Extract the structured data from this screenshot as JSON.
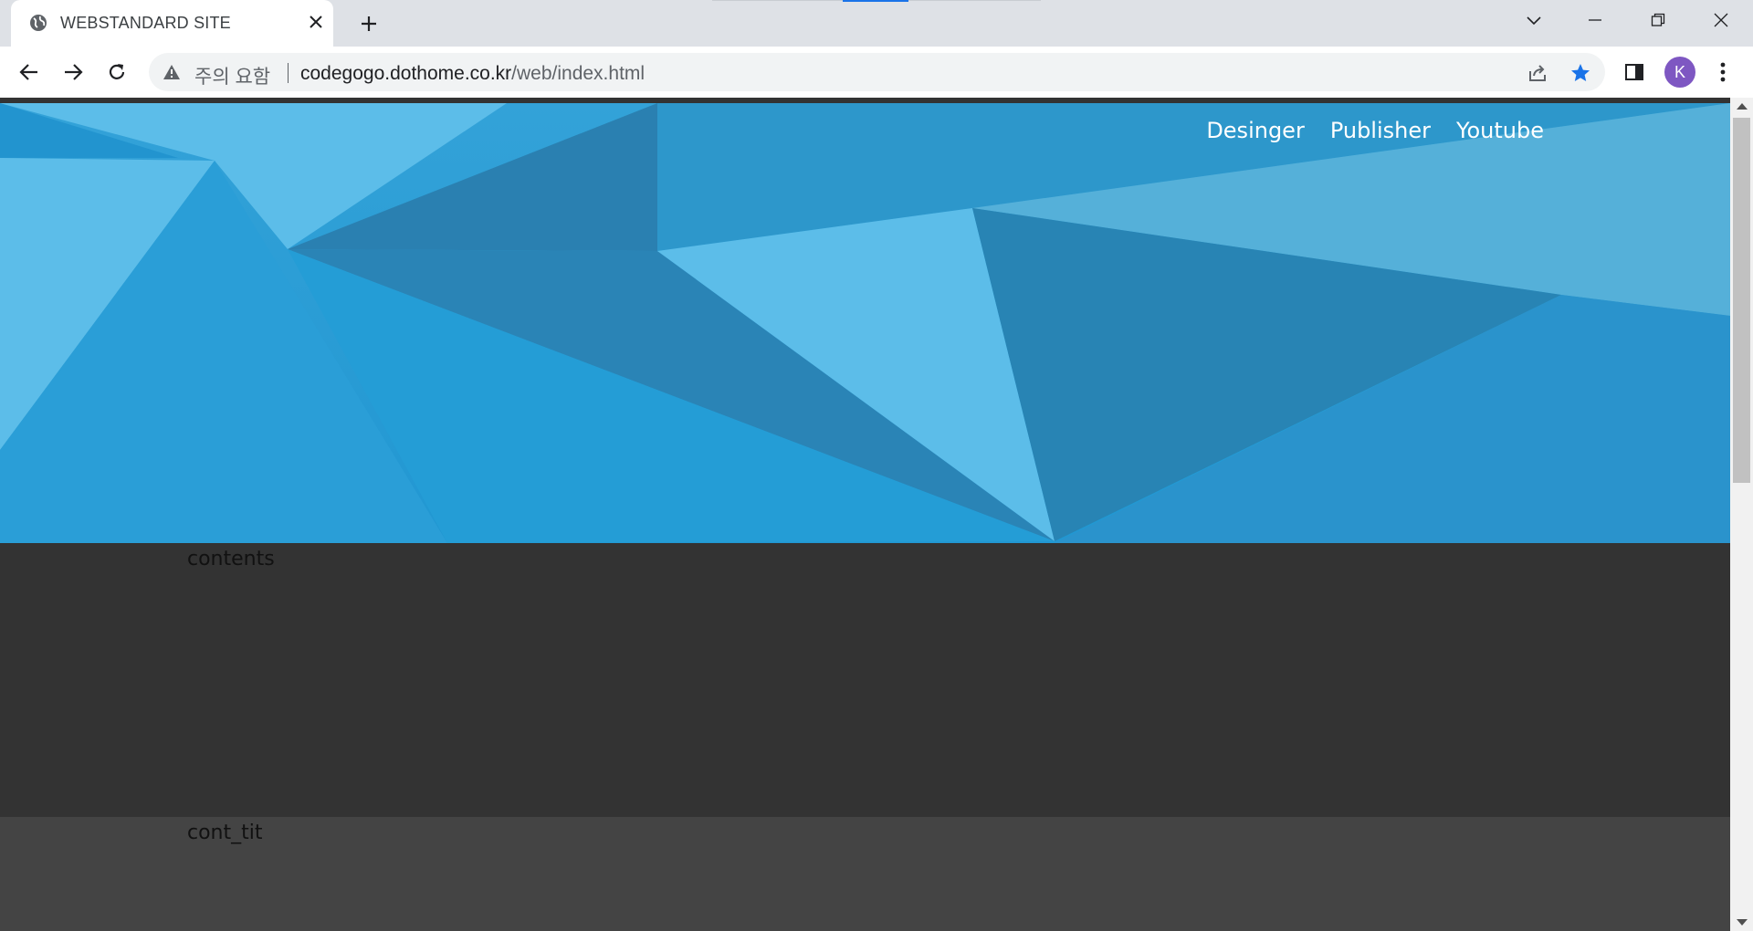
{
  "browser": {
    "tab_title": "WEBSTANDARD SITE",
    "security_label": "주의 요함",
    "url_host": "codegogo.dothome.co.kr",
    "url_path": "/web/index.html",
    "profile_initial": "K"
  },
  "site": {
    "nav": [
      "Desinger",
      "Publisher",
      "Youtube"
    ],
    "contents_label": "contents",
    "cont_tit_label": "cont_tit"
  },
  "colors": {
    "hero_blue": "#239bd4",
    "page_dark": "#333333",
    "section_gray": "#444444",
    "accent": "#1a73e8"
  }
}
